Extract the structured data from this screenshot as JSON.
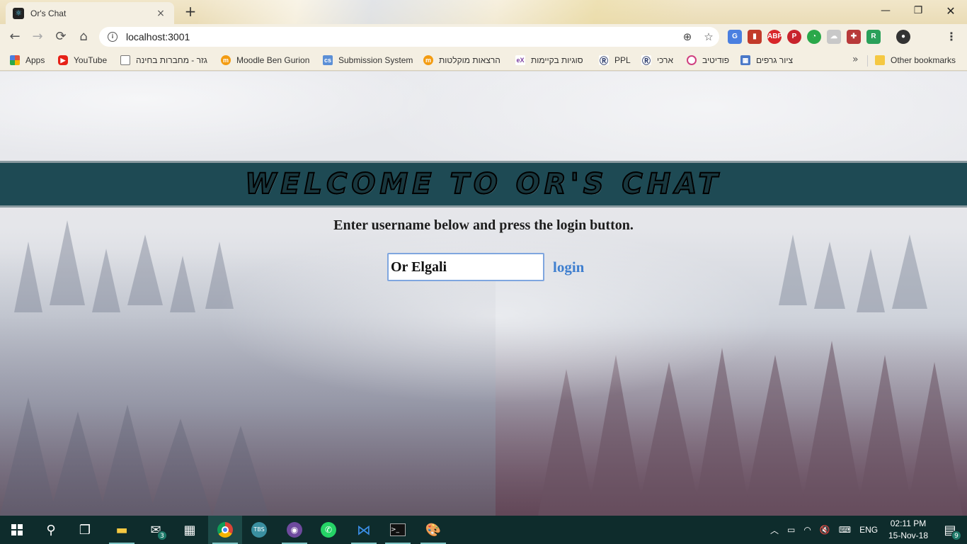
{
  "browser": {
    "tab": {
      "title": "Or's Chat",
      "close": "×"
    },
    "new_tab": "+",
    "window": {
      "minimize": "—",
      "maximize": "❐",
      "close": "✕"
    },
    "nav": {
      "back": "←",
      "forward": "→",
      "reload": "⟳",
      "home": "⌂"
    },
    "address": "localhost:3001",
    "omnibox_icons": [
      "zoom-icon",
      "star-icon"
    ],
    "menu": "⋮",
    "bookmarks": [
      {
        "label": "Apps",
        "icon": "apps-grid-icon",
        "color": "#e0533f"
      },
      {
        "label": "YouTube",
        "icon": "youtube-icon",
        "color": "#e62117"
      },
      {
        "label": "גזר - מחברות בחינה",
        "icon": "page-icon",
        "color": "#777777"
      },
      {
        "label": "Moodle Ben Gurion",
        "icon": "moodle-icon",
        "color": "#f39c12"
      },
      {
        "label": "Submission System",
        "icon": "cs-icon",
        "color": "#5b8fd6"
      },
      {
        "label": "הרצאות מוקלטות",
        "icon": "moodle-icon",
        "color": "#f39c12"
      },
      {
        "label": "סוגיות בקיימות",
        "icon": "edx-icon",
        "color": "#7b3fa0"
      },
      {
        "label": "PPL",
        "icon": "ribbon-icon",
        "color": "#2a3a6a"
      },
      {
        "label": "ארכי",
        "icon": "ribbon-icon",
        "color": "#2a3a6a"
      },
      {
        "label": "פודיטיב",
        "icon": "circle-icon",
        "color": "#d04080"
      },
      {
        "label": "ציור גרפים",
        "icon": "grid-icon",
        "color": "#4a78c8"
      }
    ],
    "bookmarks_overflow": "»",
    "other_bookmarks": "Other bookmarks"
  },
  "page": {
    "title": "Welcome to Or's Chat",
    "instruction": "Enter username below and press the login button.",
    "username_value": "Or Elgali",
    "login_label": "login"
  },
  "taskbar": {
    "mail_badge": "3",
    "clock_time": "02:11 PM",
    "clock_date": "15-Nov-18",
    "language": "ENG",
    "notification_count": "9"
  },
  "colors": {
    "banner": "#1e4a54",
    "login_link": "#3f7fcf",
    "taskbar": "#0e2c2c"
  }
}
